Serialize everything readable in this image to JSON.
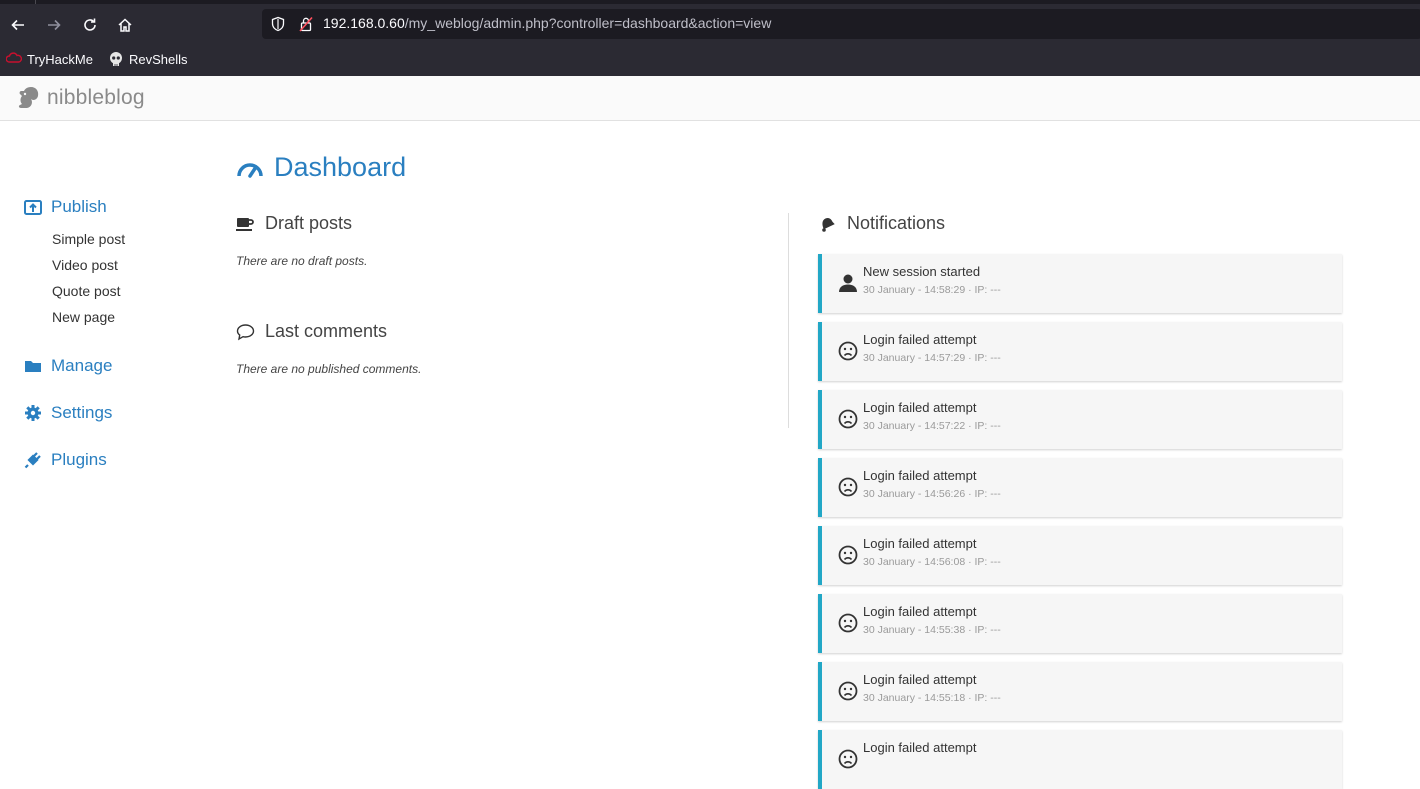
{
  "browser": {
    "url_host": "192.168.0.60",
    "url_path": "/my_weblog/admin.php?controller=dashboard&action=view",
    "bookmarks": [
      {
        "label": "TryHackMe",
        "icon": "tryhackme-icon"
      },
      {
        "label": "RevShells",
        "icon": "skull-icon"
      }
    ]
  },
  "app": {
    "logo_text": "nibbleblog"
  },
  "sidebar": {
    "publish": "Publish",
    "publish_items": [
      "Simple post",
      "Video post",
      "Quote post",
      "New page"
    ],
    "manage": "Manage",
    "settings": "Settings",
    "plugins": "Plugins"
  },
  "dashboard": {
    "title": "Dashboard",
    "draft_posts": {
      "title": "Draft posts",
      "empty": "There are no draft posts."
    },
    "last_comments": {
      "title": "Last comments",
      "empty": "There are no published comments."
    },
    "notifications": {
      "title": "Notifications",
      "items": [
        {
          "title": "New session started",
          "meta": "30 January - 14:58:29 · IP: ---",
          "icon": "user-icon"
        },
        {
          "title": "Login failed attempt",
          "meta": "30 January - 14:57:29 · IP: ---",
          "icon": "sad-face-icon"
        },
        {
          "title": "Login failed attempt",
          "meta": "30 January - 14:57:22 · IP: ---",
          "icon": "sad-face-icon"
        },
        {
          "title": "Login failed attempt",
          "meta": "30 January - 14:56:26 · IP: ---",
          "icon": "sad-face-icon"
        },
        {
          "title": "Login failed attempt",
          "meta": "30 January - 14:56:08 · IP: ---",
          "icon": "sad-face-icon"
        },
        {
          "title": "Login failed attempt",
          "meta": "30 January - 14:55:38 · IP: ---",
          "icon": "sad-face-icon"
        },
        {
          "title": "Login failed attempt",
          "meta": "30 January - 14:55:18 · IP: ---",
          "icon": "sad-face-icon"
        },
        {
          "title": "Login failed attempt",
          "meta": "",
          "icon": "sad-face-icon"
        }
      ]
    }
  },
  "colors": {
    "accent": "#2a7fc0",
    "notif_border": "#22a7c6",
    "chrome_bg": "#2b2a33"
  }
}
